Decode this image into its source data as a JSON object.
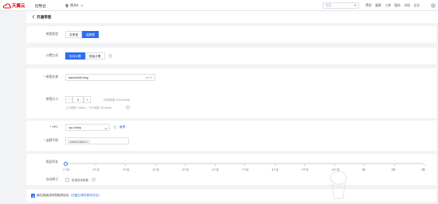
{
  "header": {
    "logo_text": "天翼云",
    "nav_console": "控制台",
    "region": "贵州1",
    "search_placeholder": "搜索",
    "links": [
      "费用",
      "备案",
      "工单",
      "服务",
      "文档",
      "企业"
    ]
  },
  "page": {
    "title": "开通带宽"
  },
  "bandwidth_type": {
    "label": "带宽类型",
    "options": [
      "共享型",
      "独享型"
    ],
    "selected": 1
  },
  "billing": {
    "label": "计费方式",
    "options": [
      "包月计费",
      "按量计费"
    ],
    "selected": 0
  },
  "name": {
    "label": "带宽名称",
    "value": "bandwidth-0wg",
    "counter": "14/74"
  },
  "size": {
    "label": "带宽大小",
    "minus": "−",
    "value": "5",
    "plus": "+",
    "unit_hint": "(可用带宽 1040 Mbit/s)",
    "range_hint": "上行带宽 1 Mbit/s，下行带宽 240 Mbit/s"
  },
  "vpc": {
    "label": "VPC",
    "value": "vpc-0ntep",
    "manage_link": "管理"
  },
  "subnet": {
    "label": "选择子网",
    "tag": "subnet-shepm ×"
  },
  "duration": {
    "label": "购买时长",
    "ticks": [
      "1个月",
      "2个月",
      "3个月",
      "4个月",
      "5个月",
      "6个月",
      "7个月",
      "8个月",
      "9个月",
      "10个月",
      "1年",
      "2年",
      "3年"
    ],
    "value_months": 1
  },
  "auto_renew": {
    "label": "自动续订",
    "option": "启用自动续费"
  },
  "agreement": {
    "text": "我已阅读并同意相关协议",
    "link": "《天翼云弹性服务协议》"
  }
}
